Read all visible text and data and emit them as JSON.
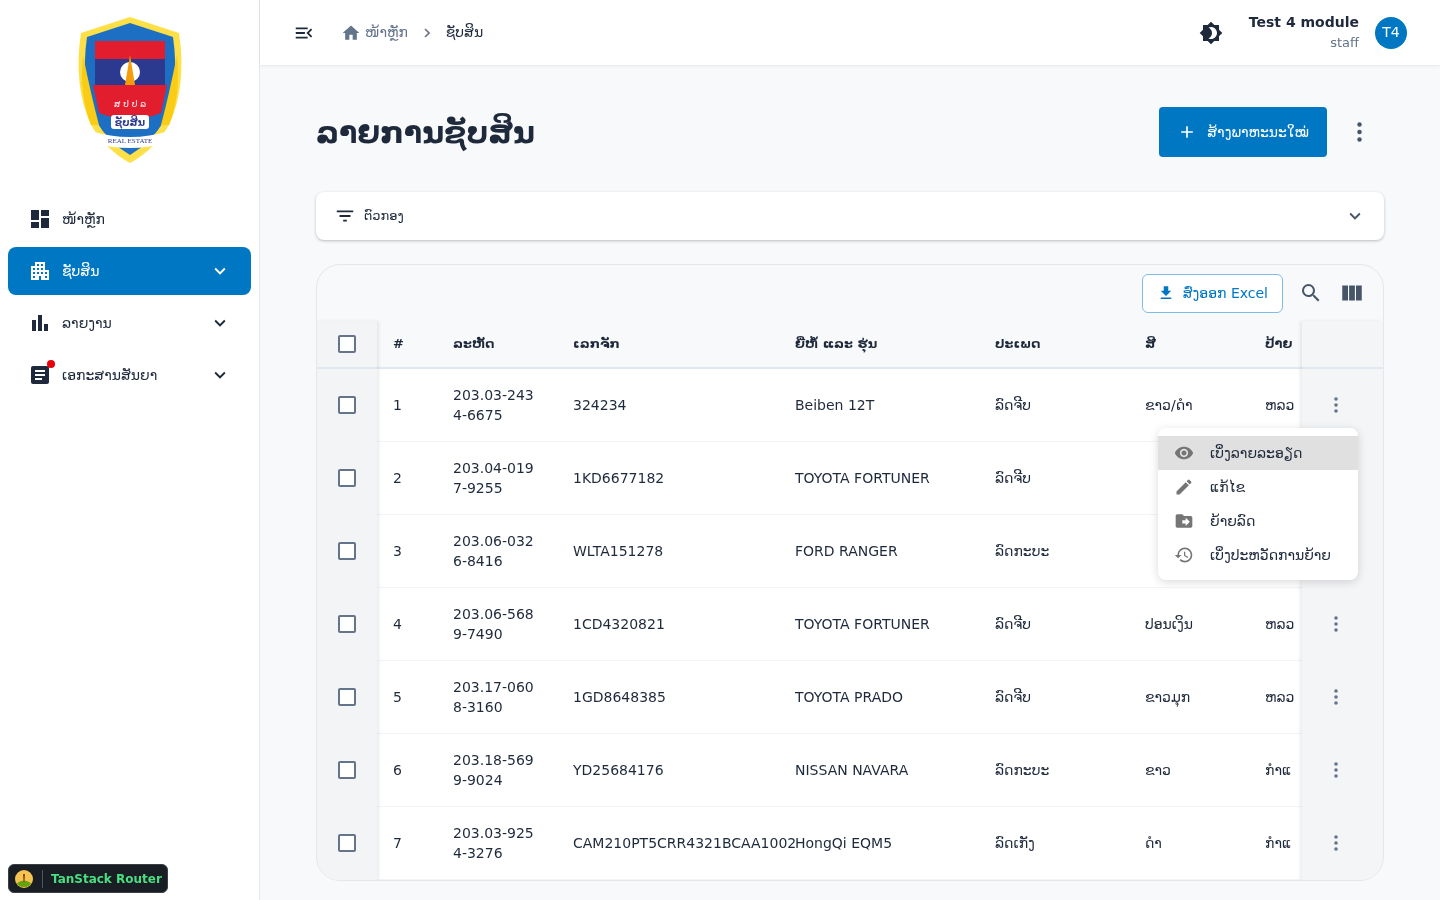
{
  "sidebar": {
    "logo": {
      "texts": [
        "ສ ປ ປ ລ",
        "ຊັບສິນ",
        "REAL ESTATE"
      ]
    },
    "items": [
      {
        "label": "ໜ້າຫຼັກ",
        "selected": false,
        "expandable": false,
        "badge": false
      },
      {
        "label": "ຊັບສິນ",
        "selected": true,
        "expandable": true,
        "badge": false
      },
      {
        "label": "ລາຍງານ",
        "selected": false,
        "expandable": true,
        "badge": false
      },
      {
        "label": "ເອກະສານສັນຍາ",
        "selected": false,
        "expandable": true,
        "badge": true
      }
    ],
    "devtools": "TanStack Router"
  },
  "header": {
    "breadcrumb": [
      {
        "label": "ໜ້າຫຼັກ",
        "kind": "home"
      },
      {
        "label": "ຊັບສິນ",
        "kind": "current"
      }
    ],
    "user": {
      "name": "Test 4 module",
      "role": "staff",
      "initials": "T4"
    }
  },
  "title": "ລາຍການຊັບສິນ",
  "create_button": "ສ້າງພາຫະນະໃໝ່",
  "filter": {
    "label": "ຕົວກອງ",
    "expanded": false
  },
  "export_button": "ສົ່ງອອກ Excel",
  "table": {
    "select_all_checked": false,
    "columns": [
      "#",
      "ລະຫັດ",
      "ເລກຈັກ",
      "ຍີ່ຫໍ້ ແລະ ຮຸ່ນ",
      "ປະເພດ",
      "ສີ",
      "ປ້າຍ"
    ],
    "rows": [
      {
        "checked": false,
        "cells": [
          "1",
          "203.03-2434-6675",
          "324234",
          "Beiben 12T",
          "ລົດຈີບ",
          "ຂາວ/ດຳ",
          "ຫລວ"
        ]
      },
      {
        "checked": false,
        "cells": [
          "2",
          "203.04-0197-9255",
          "1KD6677182",
          "TOYOTA FORTUNER",
          "ລົດຈີບ"
        ]
      },
      {
        "checked": false,
        "cells": [
          "3",
          "203.06-0326-8416",
          "WLTA151278",
          "FORD RANGER",
          "ລົດກະບະ"
        ]
      },
      {
        "checked": false,
        "cells": [
          "4",
          "203.06-5689-7490",
          "1CD4320821",
          "TOYOTA FORTUNER",
          "ລົດຈີບ",
          "ປອນເງິນ",
          "ຫລວ"
        ]
      },
      {
        "checked": false,
        "cells": [
          "5",
          "203.17-0608-3160",
          "1GD8648385",
          "TOYOTA PRADO",
          "ລົດຈີບ",
          "ຂາວມຸກ",
          "ຫລວ"
        ]
      },
      {
        "checked": false,
        "cells": [
          "6",
          "203.18-5699-9024",
          "YD25684176",
          "NISSAN NAVARA",
          "ລົດກະບະ",
          "ຂາວ",
          "ກຳແ"
        ]
      },
      {
        "checked": false,
        "cells": [
          "7",
          "203.03-9254-3276",
          "CAM210PT5CRR4321BCAA1002",
          "HongQi EQM5",
          "ລົດເກັງ",
          "ດຳ",
          "ກຳແ"
        ]
      }
    ]
  },
  "row_menu": [
    {
      "label": "ເບິ່ງລາຍລະອຽດ",
      "selected": true
    },
    {
      "label": "ແກ້ໄຂ",
      "selected": false
    },
    {
      "label": "ຍ້າຍລົດ",
      "selected": false
    },
    {
      "label": "ເບິ່ງປະຫວັດການຍ້າຍ",
      "selected": false
    }
  ]
}
